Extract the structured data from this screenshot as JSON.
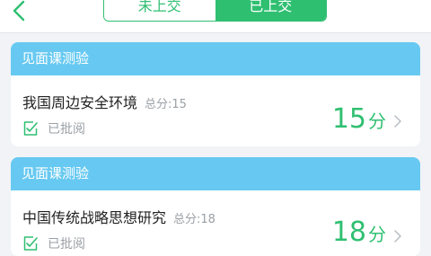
{
  "tabs": {
    "unsubmitted": "未上交",
    "submitted": "已上交"
  },
  "colors": {
    "accent": "#2fbf71",
    "header": "#67c9f1"
  },
  "cards": [
    {
      "header": "见面课测验",
      "title": "我国周边安全环境",
      "total": "总分:15",
      "status": "已批阅",
      "score": "15",
      "unit": "分"
    },
    {
      "header": "见面课测验",
      "title": "中国传统战略思想研究",
      "total": "总分:18",
      "status": "已批阅",
      "score": "18",
      "unit": "分"
    }
  ]
}
